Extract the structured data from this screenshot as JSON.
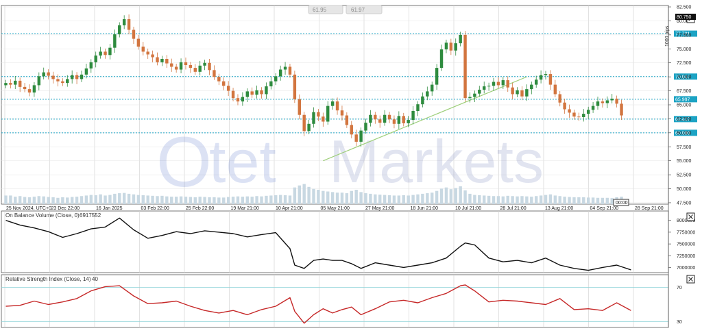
{
  "toolbar": {
    "sell_price": "61.95",
    "buy_price": "61.97"
  },
  "watermark": {
    "logo_circle": "O",
    "brand": "tet",
    "brand2": "Markets"
  },
  "chart_data": [
    {
      "type": "candlestick",
      "title": "",
      "ylim": [
        47.25,
        82.75
      ],
      "y_ticks": [
        "82.500",
        "80.000",
        "77.500",
        "75.000",
        "72.500",
        "70.000",
        "67.500",
        "65.000",
        "62.500",
        "60.000",
        "57.500",
        "55.000",
        "52.500",
        "50.000",
        "47.500"
      ],
      "x_ticks": [
        "25 Nov 2024, UTC+0",
        "23 Dec 22:00",
        "16 Jan 2025",
        "03 Feb 22:00",
        "25 Feb 22:00",
        "19 Mar 21:00",
        "10 Apr 21:00",
        "05 May 21:00",
        "27 May 21:00",
        "18 Jun 21:00",
        "10 Jul 21:00",
        "28 Jul 21:00",
        "13 Aug 21:00",
        "04 Sep 21:00",
        "28 Sep 21:00"
      ],
      "axis_label": "1000 pips",
      "current_price": "80.750",
      "current_price_color": "#111111",
      "time_marker": "00:00",
      "level_color": "#1ca3c4",
      "levels": [
        "77.721",
        "70.047",
        "65.997",
        "62.447",
        "60.000"
      ],
      "up_color": "#2e8b3e",
      "down_color": "#d2753f",
      "close": [
        68.9,
        68.6,
        69.3,
        68.2,
        67.8,
        67.2,
        68.5,
        70.1,
        70.8,
        70.2,
        69.6,
        69.2,
        68.9,
        69.6,
        70.3,
        69.6,
        70.4,
        71.5,
        72.6,
        73.8,
        74.5,
        73.9,
        75.2,
        77.6,
        79.2,
        80.3,
        78.4,
        76.8,
        75.4,
        74.5,
        74.0,
        73.5,
        72.6,
        73.2,
        72.4,
        71.8,
        71.3,
        72.6,
        72.1,
        71.6,
        70.9,
        72.0,
        72.5,
        71.2,
        70.0,
        69.2,
        68.4,
        67.5,
        66.2,
        65.6,
        66.4,
        67.4,
        66.8,
        67.6,
        66.9,
        68.3,
        69.2,
        70.1,
        71.3,
        71.8,
        70.4,
        66.0,
        63.2,
        60.3,
        61.6,
        63.7,
        62.9,
        62.0,
        64.8,
        65.6,
        64.0,
        63.1,
        61.4,
        59.7,
        58.4,
        60.4,
        61.8,
        63.2,
        62.4,
        61.8,
        63.2,
        62.4,
        61.6,
        63.0,
        61.7,
        62.3,
        63.9,
        65.1,
        66.5,
        67.4,
        68.6,
        71.6,
        74.9,
        76.1,
        74.7,
        76.0,
        77.5,
        66.2,
        66.4,
        67.0,
        67.7,
        68.3,
        68.4,
        69.1,
        68.5,
        69.4,
        68.1,
        66.9,
        67.6,
        66.5,
        67.8,
        68.6,
        69.5,
        70.3,
        70.5,
        68.6,
        66.9,
        65.4,
        64.2,
        63.6,
        62.9,
        62.8,
        63.4,
        64.1,
        64.8,
        65.6,
        65.3,
        65.8,
        66.1,
        65.2,
        63.1
      ],
      "volume": [
        3,
        3,
        2.6,
        2.8,
        2.5,
        2.4,
        2.6,
        2.8,
        2.7,
        2.5,
        2.4,
        2.2,
        2.4,
        2.3,
        2.5,
        2.6,
        2.8,
        3,
        3.2,
        3.1,
        3.4,
        3,
        3.2,
        3.6,
        3.8,
        3.9,
        3.6,
        3.4,
        3.2,
        3.1,
        3,
        2.9,
        2.8,
        2.9,
        2.7,
        2.6,
        2.6,
        2.7,
        2.6,
        2.5,
        2.4,
        2.6,
        2.5,
        2.4,
        2.4,
        2.3,
        2.3,
        2.5,
        2.6,
        2.7,
        2.6,
        2.7,
        2.6,
        2.8,
        2.7,
        2.9,
        3,
        3.1,
        3.2,
        3.1,
        3,
        5.8,
        6.5,
        7,
        6,
        5.3,
        5,
        4.6,
        4.4,
        4.2,
        4,
        4,
        3.8,
        4.6,
        5,
        4.2,
        3.8,
        3.6,
        3.4,
        3.3,
        3.2,
        3.1,
        3,
        3,
        3.1,
        3,
        3.2,
        3.4,
        3.6,
        3.8,
        4,
        4.6,
        5.4,
        5.8,
        5.2,
        5.6,
        6.2,
        4.8,
        3.6,
        3.2,
        3.1,
        3,
        2.9,
        2.8,
        2.8,
        2.7,
        2.9,
        2.8,
        2.7,
        2.8,
        2.7,
        2.6,
        2.8,
        3,
        3.2,
        3.4,
        3.0,
        2.8,
        2.6,
        2.5,
        2.4,
        2.4,
        2.4,
        2.3,
        2.3,
        2.2,
        2.2,
        2.2,
        2.1,
        2.4,
        2.6
      ],
      "trendline": {
        "from": [
          67,
          55.0
        ],
        "to": [
          110,
          70.0
        ],
        "color": "#9ecf7a"
      }
    },
    {
      "type": "line",
      "title": "On Balance Volume (Close, 0)",
      "value_label": "6917552",
      "ylim": [
        6890000,
        8200000
      ],
      "y_ticks": [
        "8000000",
        "7750000",
        "7500000",
        "7250000",
        "7000000"
      ],
      "color": "#111111",
      "x": [
        0,
        3,
        6,
        9,
        12,
        15,
        18,
        21,
        24,
        27,
        30,
        33,
        36,
        39,
        42,
        45,
        48,
        51,
        54,
        57,
        60,
        61,
        63,
        65,
        67,
        69,
        71,
        73,
        75,
        78,
        81,
        84,
        87,
        90,
        93,
        96,
        97,
        99,
        102,
        105,
        108,
        111,
        114,
        117,
        120,
        123,
        126,
        129,
        132
      ],
      "y": [
        8000000,
        7900000,
        7840000,
        7760000,
        7640000,
        7720000,
        7820000,
        7860000,
        8050000,
        7800000,
        7620000,
        7680000,
        7760000,
        7720000,
        7780000,
        7750000,
        7720000,
        7650000,
        7700000,
        7740000,
        7400000,
        7050000,
        6980000,
        7150000,
        7180000,
        7150000,
        7150000,
        7080000,
        6980000,
        7100000,
        7050000,
        7000000,
        7050000,
        7100000,
        7200000,
        7450000,
        7520000,
        7480000,
        7200000,
        7120000,
        7150000,
        7100000,
        7200000,
        7050000,
        6980000,
        6940000,
        7000000,
        7050000,
        6950000
      ]
    },
    {
      "type": "line",
      "title": "Relative Strength Index (Close, 14)",
      "value_label": "40",
      "ylim": [
        23,
        85
      ],
      "y_ticks": [
        "70",
        "30"
      ],
      "levels": [
        70,
        30
      ],
      "color": "#c62828",
      "x": [
        0,
        3,
        6,
        9,
        12,
        15,
        18,
        21,
        24,
        27,
        30,
        33,
        36,
        39,
        42,
        45,
        48,
        51,
        54,
        57,
        60,
        61,
        63,
        65,
        67,
        69,
        71,
        73,
        75,
        78,
        81,
        84,
        87,
        90,
        93,
        96,
        97,
        99,
        102,
        105,
        108,
        111,
        114,
        117,
        120,
        123,
        126,
        129,
        132
      ],
      "y": [
        48,
        49,
        54,
        50,
        53,
        57,
        66,
        71,
        72,
        60,
        51,
        52,
        54,
        48,
        43,
        40,
        43,
        38,
        44,
        48,
        58,
        42,
        28,
        38,
        45,
        40,
        44,
        47,
        38,
        45,
        53,
        55,
        52,
        58,
        63,
        72,
        73,
        66,
        53,
        55,
        54,
        52,
        50,
        57,
        44,
        45,
        43,
        52,
        43
      ]
    }
  ]
}
